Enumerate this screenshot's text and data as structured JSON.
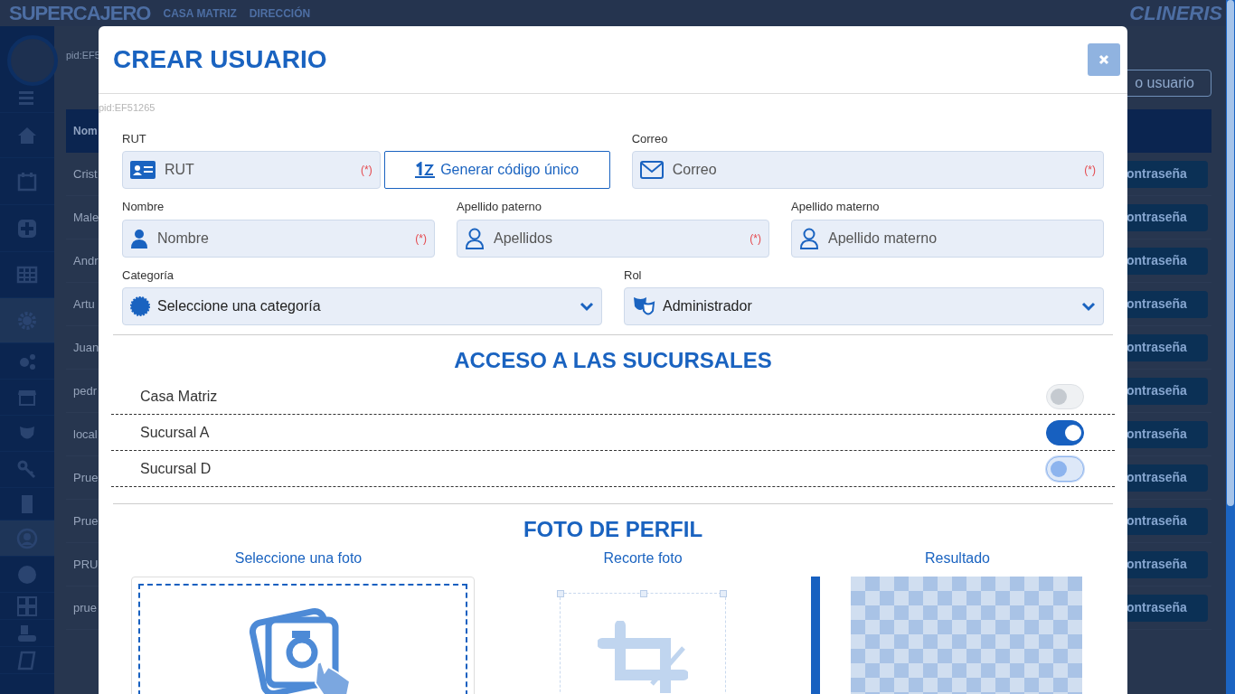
{
  "app": {
    "title": "SUPERCAJERO",
    "breadcrumb": [
      "CASA MATRIZ",
      "DIRECCIÓN"
    ],
    "logo": "CLINERIS"
  },
  "sidebar": {
    "items": [
      {
        "selected": false
      },
      {
        "selected": false
      },
      {
        "selected": false
      },
      {
        "selected": false
      },
      {
        "selected": false
      },
      {
        "selected": true
      },
      {
        "selected": false
      },
      {
        "selected": false
      },
      {
        "selected": false
      },
      {
        "selected": false
      },
      {
        "selected": false
      },
      {
        "selected": true
      },
      {
        "selected": false
      },
      {
        "selected": false
      },
      {
        "selected": false
      },
      {
        "selected": false
      }
    ]
  },
  "pid": "pid:EF5",
  "new_user_button": "o usuario",
  "table": {
    "columns": [
      "Nom"
    ],
    "rows": [
      {
        "column_1": "Crist",
        "action": "ontraseña"
      },
      {
        "column_1": "Male",
        "action": "ontraseña"
      },
      {
        "column_1": "Andr",
        "action": "ontraseña"
      },
      {
        "column_1": "Artu",
        "action": "ontraseña"
      },
      {
        "column_1": "Juan",
        "action": "ontraseña"
      },
      {
        "column_1": "pedr",
        "action": "ontraseña"
      },
      {
        "column_1": "local",
        "action": "ontraseña"
      },
      {
        "column_1": "Prue",
        "action": "ontraseña"
      },
      {
        "column_1": "Prue",
        "action": "ontraseña"
      },
      {
        "column_1": "PRU",
        "action": "ontraseña"
      },
      {
        "column_1": "prue",
        "action": "ontraseña"
      }
    ]
  },
  "modal": {
    "title": "CREAR USUARIO",
    "pid": "pid:EF51265",
    "form_rows": [
      [
        {
          "kind": "text",
          "label": "RUT",
          "placeholder": "RUT",
          "required_mark": "(*)",
          "button": "Generar código único"
        },
        {
          "kind": "text",
          "label": "Correo",
          "placeholder": "Correo",
          "required_mark": "(*)"
        }
      ],
      [
        {
          "kind": "text",
          "label": "Nombre",
          "placeholder": "Nombre",
          "required_mark": "(*)"
        },
        {
          "kind": "text",
          "label": "Apellido paterno",
          "placeholder": "Apellidos",
          "required_mark": "(*)"
        },
        {
          "kind": "text",
          "label": "Apellido materno",
          "placeholder": "Apellido materno"
        }
      ],
      [
        {
          "kind": "select",
          "label": "Categoría",
          "value": "Seleccione una categoría"
        },
        {
          "kind": "select",
          "label": "Rol",
          "value": "Administrador"
        }
      ]
    ],
    "branches": {
      "title": "ACCESO A LAS SUCURSALES",
      "items": [
        {
          "label": "Casa Matriz",
          "on": false,
          "disabled": true
        },
        {
          "label": "Sucursal A",
          "on": true,
          "disabled": false
        },
        {
          "label": "Sucursal D",
          "on": false,
          "disabled": false
        }
      ]
    },
    "photo": {
      "title": "FOTO DE PERFIL",
      "columns": [
        "Seleccione una foto",
        "Recorte foto",
        "Resultado"
      ]
    }
  }
}
